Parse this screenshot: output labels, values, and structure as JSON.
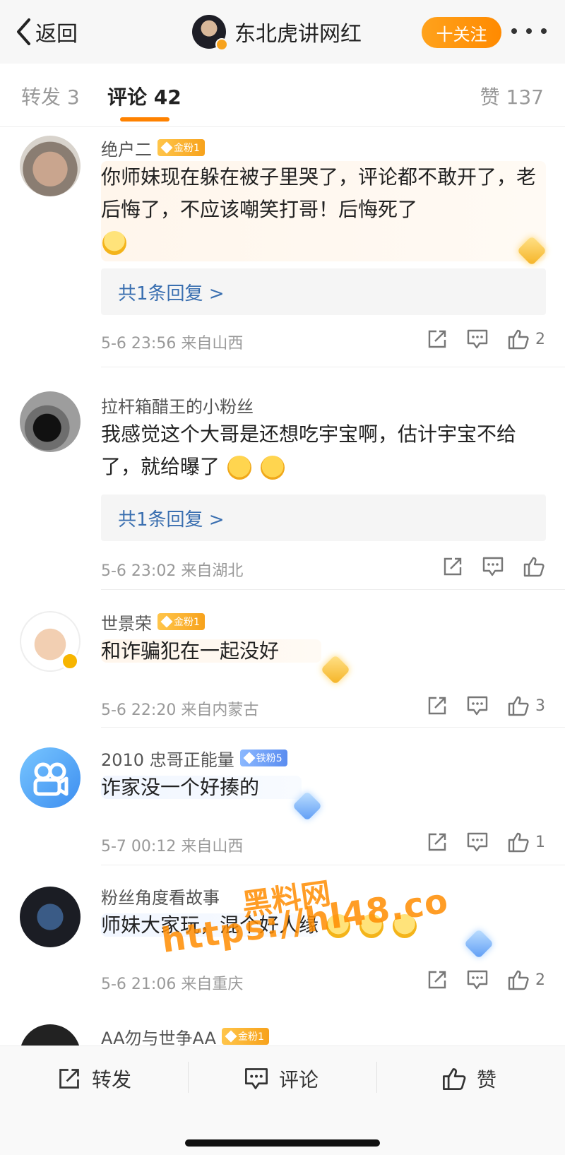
{
  "header": {
    "back_label": "返回",
    "title": "东北虎讲网红",
    "follow_label": "十关注"
  },
  "tabs": {
    "repost": "转发 3",
    "comments": "评论 42",
    "likes": "赞 137"
  },
  "comments": [
    {
      "user": "绝户二",
      "badge": "金粉1",
      "text": "你师妹现在躲在被子里哭了，评论都不敢开了，老后悔了，不应该嘲笑打哥！后悔死了",
      "emoji": "laugh-cry-icon",
      "reply_label": "共1条回复 >",
      "meta": "5-6 23:56 来自山西",
      "likes": "2"
    },
    {
      "user": "拉杆箱醋王的小粉丝",
      "text": "我感觉这个大哥是还想吃宇宝啊，估计宇宝不给了，就给曝了",
      "emoji": "thinking-icon",
      "reply_label": "共1条回复 >",
      "meta": "5-6 23:02 来自湖北"
    },
    {
      "user": "世景荣",
      "badge": "金粉1",
      "text": "和诈骗犯在一起没好",
      "meta": "5-6 22:20 来自内蒙古",
      "likes": "3"
    },
    {
      "user": "2010 忠哥正能量",
      "badge": "铁粉5",
      "text": "诈家没一个好揍的",
      "meta": "5-7 00:12 来自山西",
      "likes": "1"
    },
    {
      "user": "粉丝角度看故事",
      "text": "师妹大家玩，混个好人缘",
      "emoji": "laugh-cry-icon",
      "meta": "5-6 21:06 来自重庆",
      "likes": "2"
    },
    {
      "user": "AA勿与世争AA",
      "badge": "金粉1"
    }
  ],
  "watermark": {
    "line1": "黑料网",
    "line2": "https://hl48.co"
  },
  "bottom": {
    "repost": "转发",
    "comment": "评论",
    "like": "赞"
  },
  "colors": {
    "accent": "#ff8200",
    "link": "#3a6fb0",
    "gold_badge": "#f7a21c",
    "iron_badge": "#5a8cf0"
  }
}
